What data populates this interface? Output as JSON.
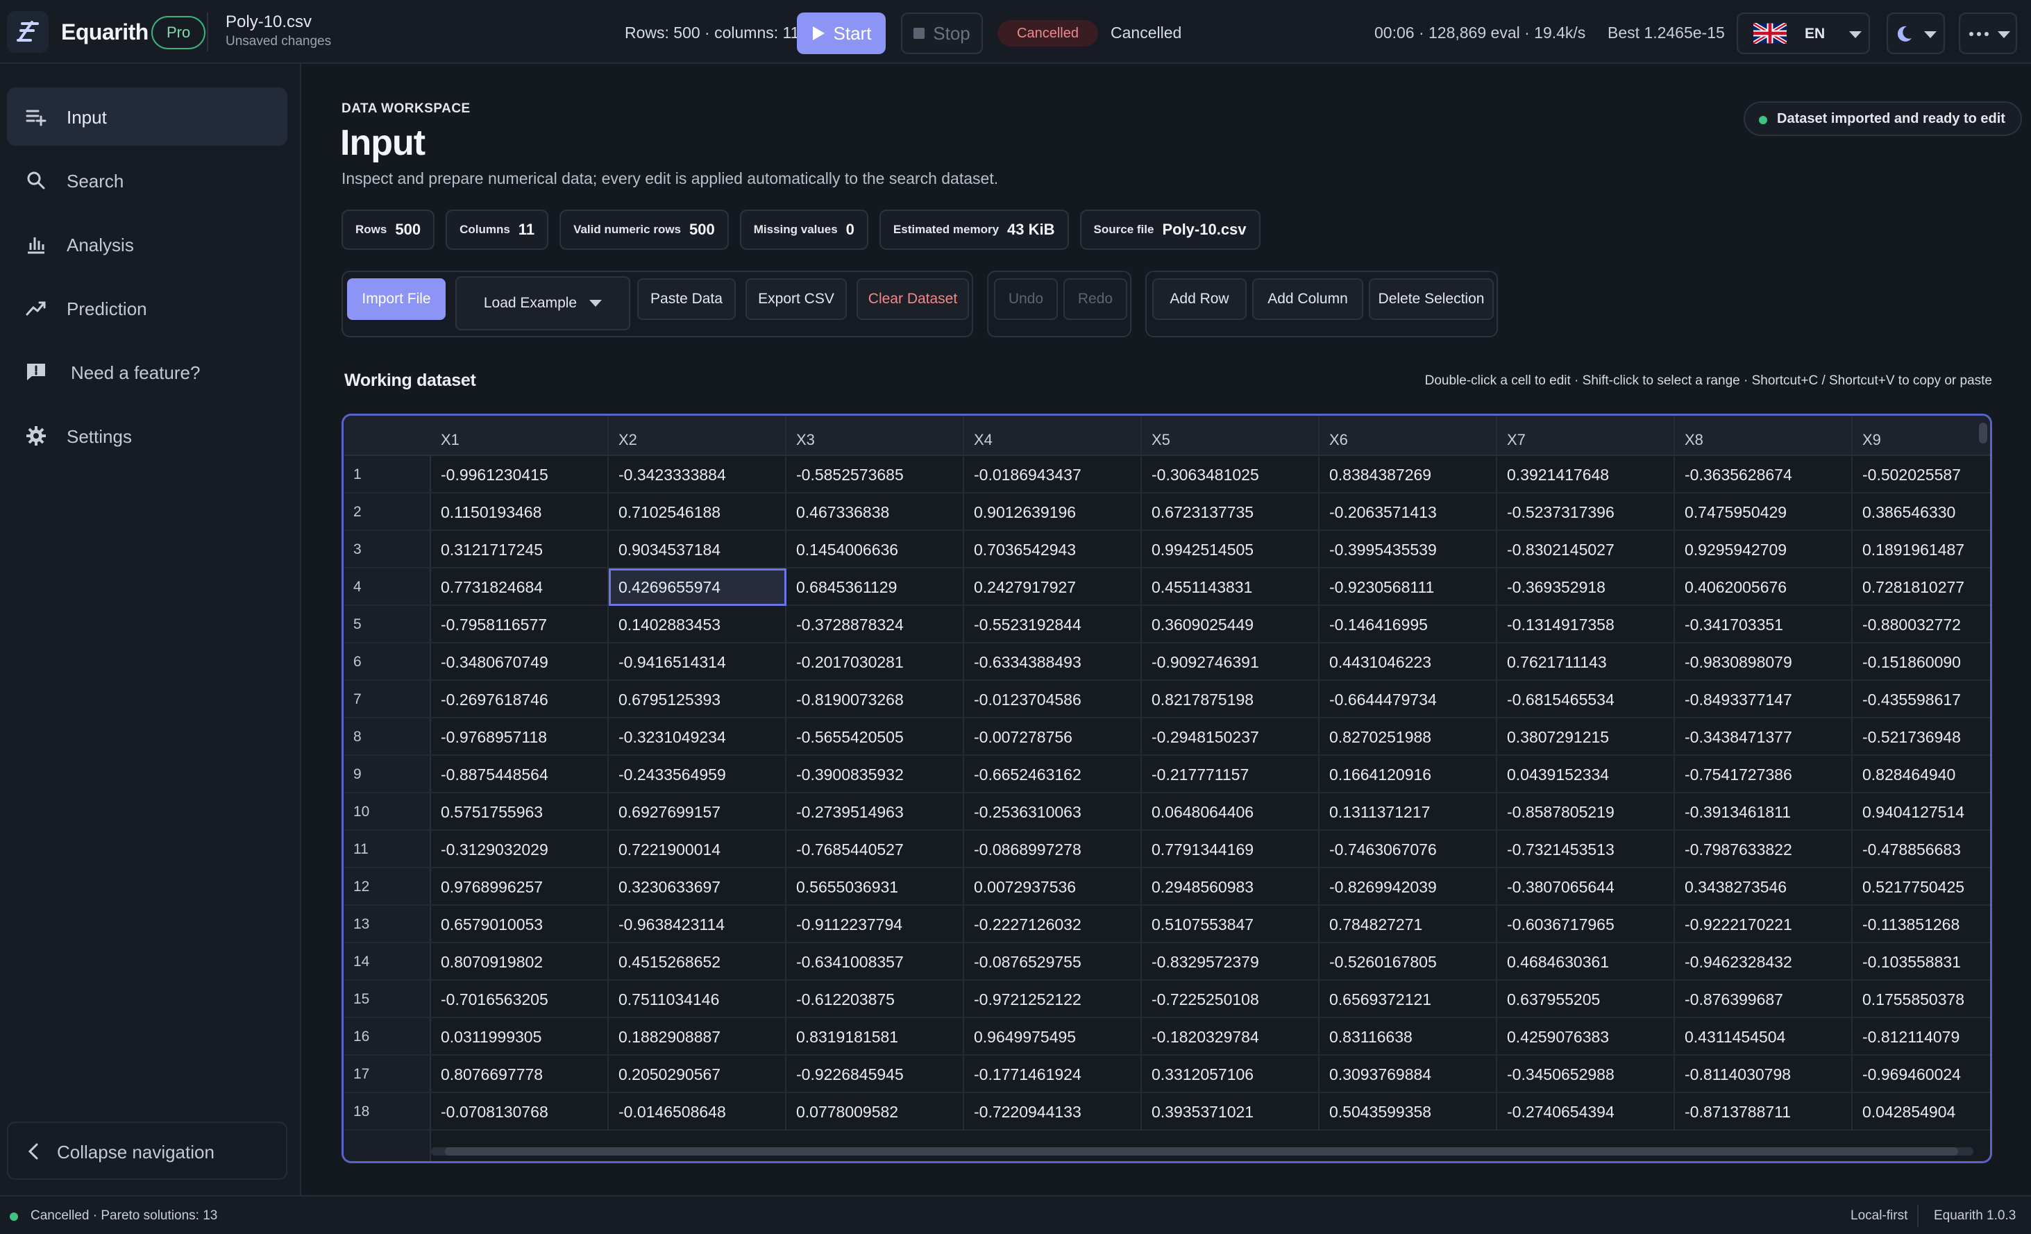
{
  "topbar": {
    "brand": "Equarith",
    "badge": "Pro",
    "file_name": "Poly-10.csv",
    "file_status": "Unsaved changes",
    "rows_info": "Rows: 500 · columns: 11",
    "start_label": "Start",
    "stop_label": "Stop",
    "status_pill": "Cancelled",
    "status_text": "Cancelled",
    "eval_info": "00:06 · 128,869 eval · 19.4k/s",
    "best_info": "Best 1.2465e-15",
    "language": "EN"
  },
  "sidebar": {
    "items": [
      {
        "label": "Input",
        "icon": "input-list-icon"
      },
      {
        "label": "Search",
        "icon": "search-icon"
      },
      {
        "label": "Analysis",
        "icon": "bar-chart-icon"
      },
      {
        "label": "Prediction",
        "icon": "trend-icon"
      },
      {
        "label": "Need a feature?",
        "icon": "feedback-icon"
      },
      {
        "label": "Settings",
        "icon": "gear-icon"
      }
    ],
    "collapse_label": "Collapse navigation"
  },
  "header": {
    "eyebrow": "DATA WORKSPACE",
    "title": "Input",
    "description": "Inspect and prepare numerical data; every edit is applied automatically to the search dataset.",
    "ready_status": "Dataset imported and ready to edit"
  },
  "stats": [
    {
      "key": "Rows",
      "value": "500"
    },
    {
      "key": "Columns",
      "value": "11"
    },
    {
      "key": "Valid numeric rows",
      "value": "500"
    },
    {
      "key": "Missing values",
      "value": "0"
    },
    {
      "key": "Estimated memory",
      "value": "43 KiB"
    },
    {
      "key": "Source file",
      "value": "Poly-10.csv"
    }
  ],
  "toolbar": {
    "import": "Import File",
    "load_example": "Load Example",
    "paste": "Paste Data",
    "export": "Export CSV",
    "clear": "Clear Dataset",
    "undo": "Undo",
    "redo": "Redo",
    "add_row": "Add Row",
    "add_column": "Add Column",
    "delete_selection": "Delete Selection"
  },
  "dataset": {
    "title": "Working dataset",
    "hint": "Double-click a cell to edit · Shift-click to select a range · Shortcut+C / Shortcut+V to copy or paste",
    "columns": [
      "X1",
      "X2",
      "X3",
      "X4",
      "X5",
      "X6",
      "X7",
      "X8",
      "X9"
    ],
    "rows": [
      [
        "1",
        "-0.9961230415",
        "-0.3423333884",
        "-0.5852573685",
        "-0.0186943437",
        "-0.3063481025",
        "0.8384387269",
        "0.3921417648",
        "-0.3635628674",
        "-0.502025587"
      ],
      [
        "2",
        "0.1150193468",
        "0.7102546188",
        "0.467336838",
        "0.9012639196",
        "0.6723137735",
        "-0.2063571413",
        "-0.5237317396",
        "0.7475950429",
        "0.386546330"
      ],
      [
        "3",
        "0.3121717245",
        "0.9034537184",
        "0.1454006636",
        "0.7036542943",
        "0.9942514505",
        "-0.3995435539",
        "-0.8302145027",
        "0.9295942709",
        "0.1891961487"
      ],
      [
        "4",
        "0.7731824684",
        "0.4269655974",
        "0.6845361129",
        "0.2427917927",
        "0.4551143831",
        "-0.9230568111",
        "-0.369352918",
        "0.4062005676",
        "0.7281810277"
      ],
      [
        "5",
        "-0.7958116577",
        "0.1402883453",
        "-0.3728878324",
        "-0.5523192844",
        "0.3609025449",
        "-0.146416995",
        "-0.1314917358",
        "-0.341703351",
        "-0.880032772"
      ],
      [
        "6",
        "-0.3480670749",
        "-0.9416514314",
        "-0.2017030281",
        "-0.6334388493",
        "-0.9092746391",
        "0.4431046223",
        "0.7621711143",
        "-0.9830898079",
        "-0.151860090"
      ],
      [
        "7",
        "-0.2697618746",
        "0.6795125393",
        "-0.8190073268",
        "-0.0123704586",
        "0.8217875198",
        "-0.6644479734",
        "-0.6815465534",
        "-0.8493377147",
        "-0.435598617"
      ],
      [
        "8",
        "-0.9768957118",
        "-0.3231049234",
        "-0.5655420505",
        "-0.007278756",
        "-0.2948150237",
        "0.8270251988",
        "0.3807291215",
        "-0.3438471377",
        "-0.521736948"
      ],
      [
        "9",
        "-0.8875448564",
        "-0.2433564959",
        "-0.3900835932",
        "-0.6652463162",
        "-0.217771157",
        "0.1664120916",
        "0.0439152334",
        "-0.7541727386",
        "0.828464940"
      ],
      [
        "10",
        "0.5751755963",
        "0.6927699157",
        "-0.2739514963",
        "-0.2536310063",
        "0.0648064406",
        "0.1311371217",
        "-0.8587805219",
        "-0.3913461811",
        "0.9404127514"
      ],
      [
        "11",
        "-0.3129032029",
        "0.7221900014",
        "-0.7685440527",
        "-0.0868997278",
        "0.7791344169",
        "-0.7463067076",
        "-0.7321453513",
        "-0.7987633822",
        "-0.478856683"
      ],
      [
        "12",
        "0.9768996257",
        "0.3230633697",
        "0.5655036931",
        "0.0072937536",
        "0.2948560983",
        "-0.8269942039",
        "-0.3807065644",
        "0.3438273546",
        "0.5217750425"
      ],
      [
        "13",
        "0.6579010053",
        "-0.9638423114",
        "-0.9112237794",
        "-0.2227126032",
        "0.5107553847",
        "0.784827271",
        "-0.6036717965",
        "-0.9222170221",
        "-0.113851268"
      ],
      [
        "14",
        "0.8070919802",
        "0.4515268652",
        "-0.6341008357",
        "-0.0876529755",
        "-0.8329572379",
        "-0.5260167805",
        "0.4684630361",
        "-0.9462328432",
        "-0.103558831"
      ],
      [
        "15",
        "-0.7016563205",
        "0.7511034146",
        "-0.612203875",
        "-0.9721252122",
        "-0.7225250108",
        "0.6569372121",
        "0.637955205",
        "-0.876399687",
        "0.1755850378"
      ],
      [
        "16",
        "0.0311999305",
        "0.1882908887",
        "0.8319181581",
        "0.9649975495",
        "-0.1820329784",
        "0.83116638",
        "0.4259076383",
        "0.4311454504",
        "-0.812114079"
      ],
      [
        "17",
        "0.8076697778",
        "0.2050290567",
        "-0.9226845945",
        "-0.1771461924",
        "0.3312057106",
        "0.3093769884",
        "-0.3450652988",
        "-0.8114030798",
        "-0.969460024"
      ],
      [
        "18",
        "-0.0708130768",
        "-0.0146508648",
        "0.0778009582",
        "-0.7220944133",
        "0.3935371021",
        "0.5043599358",
        "-0.2740654394",
        "-0.8713788711",
        "0.042854904"
      ]
    ]
  },
  "statusbar": {
    "left": "Cancelled · Pareto solutions: 13",
    "mode": "Local-first",
    "version": "Equarith 1.0.3"
  }
}
